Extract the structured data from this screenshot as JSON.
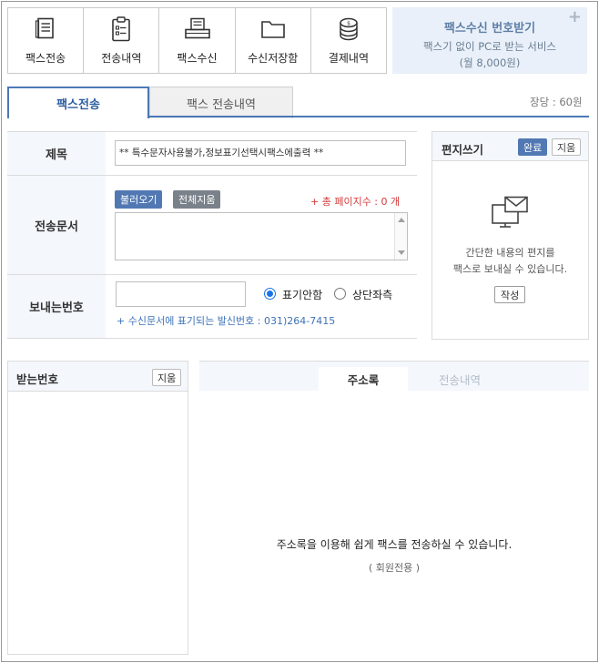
{
  "menu": [
    {
      "label": "팩스전송",
      "icon": "fax-document-icon"
    },
    {
      "label": "전송내역",
      "icon": "clipboard-checklist-icon"
    },
    {
      "label": "팩스수신",
      "icon": "fax-machine-icon"
    },
    {
      "label": "수신저장함",
      "icon": "folder-icon"
    },
    {
      "label": "결제내역",
      "icon": "coin-stack-icon"
    }
  ],
  "promo": {
    "title": "팩스수신 번호받기",
    "subtitle": "팩스기 없이 PC로 받는 서비스",
    "price": "(월 8,000원)",
    "plus": "+"
  },
  "tabs": {
    "active": "팩스전송",
    "inactive": "팩스 전송내역"
  },
  "unit_price": "장당 : 60원",
  "form": {
    "subject_label": "제목",
    "subject_value": "** 특수문자사용불가,정보표기선택시팩스에출력 **",
    "message_label": "전송문서",
    "load_button": "불러오기",
    "clear_all_button": "전체지움",
    "total_pages": "+ 총 페이지수 : 0 개",
    "sender_label": "보내는번호",
    "radio_hide": "표기안함",
    "radio_top_left": "상단좌측",
    "sender_note": "+ 수신문서에 표기되는 발신번호 : 031)264-7415"
  },
  "letter": {
    "title": "편지쓰기",
    "done_button": "완료",
    "clear_button": "지움",
    "desc_line1": "간단한 내용의 편지를",
    "desc_line2": "팩스로 보내실 수 있습니다.",
    "write_button": "작성"
  },
  "receiver": {
    "title": "받는번호",
    "clear_button": "지움"
  },
  "address": {
    "tab_address_book": "주소록",
    "tab_history": "전송내역",
    "message": "주소록을 이용해 쉽게 팩스를 전송하실 수 있습니다.",
    "sub_message": "( 회원전용 )"
  },
  "colors": {
    "accent": "#4c78b5",
    "button_blue": "#5178b3",
    "button_gray": "#7a818a",
    "warning": "#d43a3a",
    "header_bg": "#f4f7fc",
    "promo_bg": "#e9f0f9"
  }
}
